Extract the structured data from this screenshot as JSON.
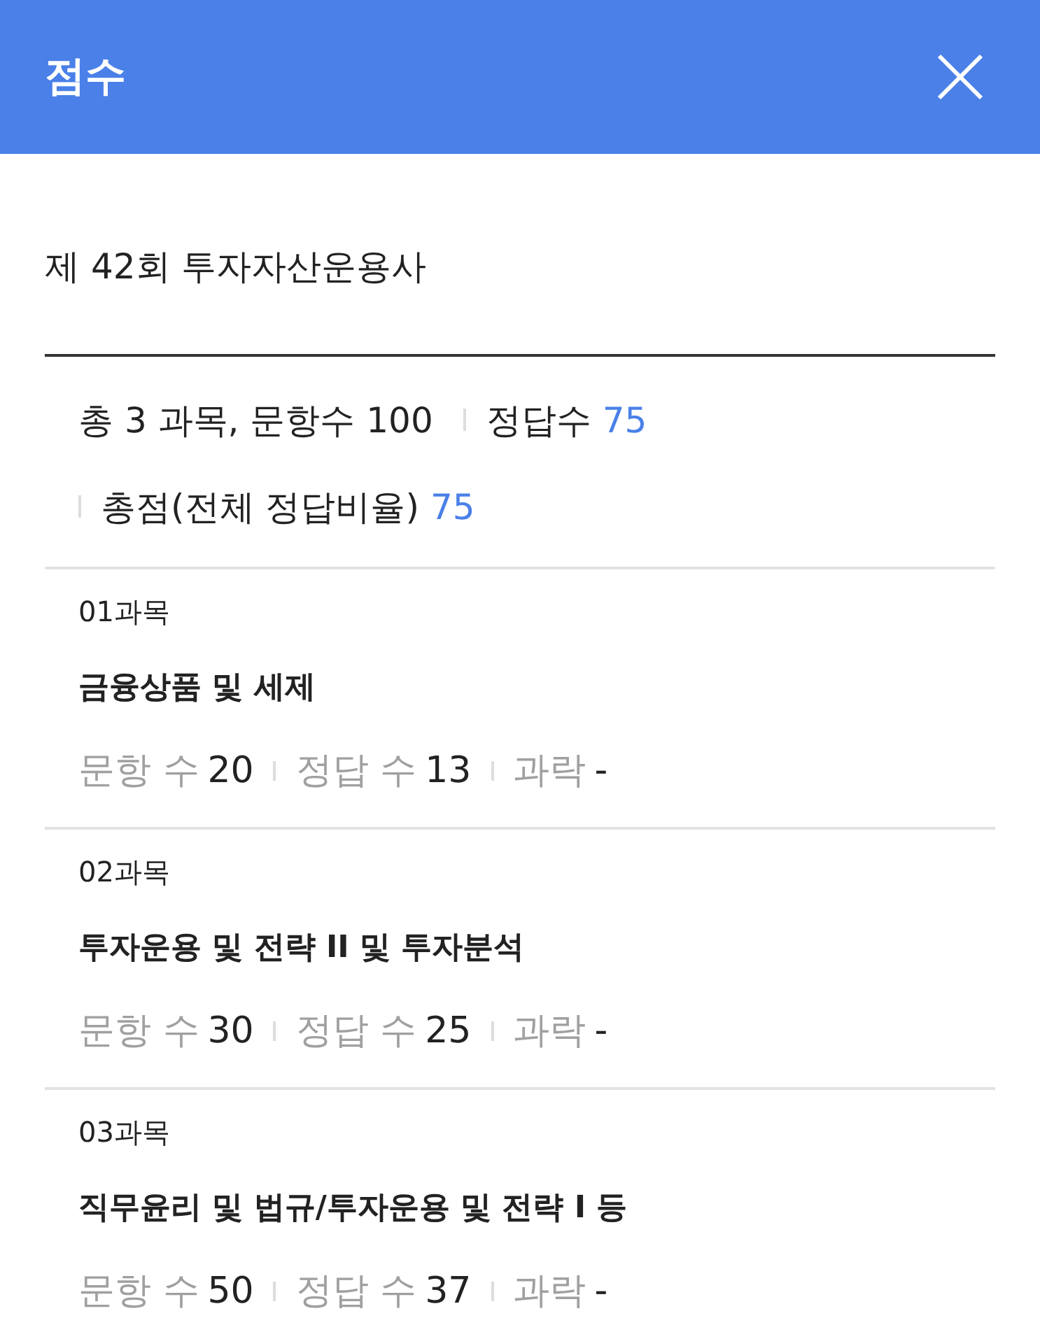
{
  "header": {
    "title": "점수"
  },
  "exam_title": "제 42회 투자자산운용사",
  "summary_lines": [
    [
      {
        "label": "총 3 과목, 문항수 100"
      },
      {
        "label": "정답수",
        "value": "75"
      }
    ],
    [
      {
        "label": "총점(전체 정답비율)",
        "value": "75"
      }
    ]
  ],
  "subjects": [
    {
      "number": "01과목",
      "name": "금융상품 및 세제",
      "stats": [
        {
          "label": "문항 수",
          "value": "20"
        },
        {
          "label": "정답 수",
          "value": "13"
        },
        {
          "label": "과락",
          "value": "-"
        }
      ]
    },
    {
      "number": "02과목",
      "name": "투자운용 및 전략 II 및 투자분석",
      "stats": [
        {
          "label": "문항 수",
          "value": "30"
        },
        {
          "label": "정답 수",
          "value": "25"
        },
        {
          "label": "과락",
          "value": "-"
        }
      ]
    },
    {
      "number": "03과목",
      "name": "직무윤리 및 법규/투자운용 및 전략 I  등",
      "stats": [
        {
          "label": "문항 수",
          "value": "50"
        },
        {
          "label": "정답 수",
          "value": "37"
        },
        {
          "label": "과락",
          "value": "-"
        }
      ]
    }
  ]
}
